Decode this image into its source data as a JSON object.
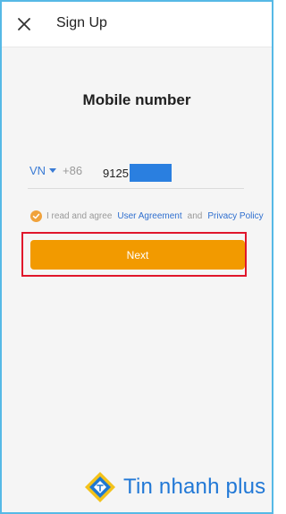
{
  "header": {
    "title": "Sign Up"
  },
  "page_title": "Mobile number",
  "phone": {
    "country": "VN",
    "dial_code": "+86",
    "number_visible": "9125"
  },
  "agreement": {
    "prefix": "I read and agree",
    "user_agreement": "User Agreement",
    "conjunction": "and",
    "privacy_policy": "Privacy Policy"
  },
  "next_label": "Next",
  "watermark": {
    "text": "Tin nhanh plus"
  },
  "colors": {
    "accent": "#f29a00",
    "link": "#2f6fcf",
    "highlight": "#e0162b",
    "frame": "#56b9e6"
  },
  "icons": {
    "close": "close-icon",
    "caret": "caret-down-icon",
    "check": "check-circle-icon",
    "logo": "tin-nhanh-plus-logo"
  }
}
